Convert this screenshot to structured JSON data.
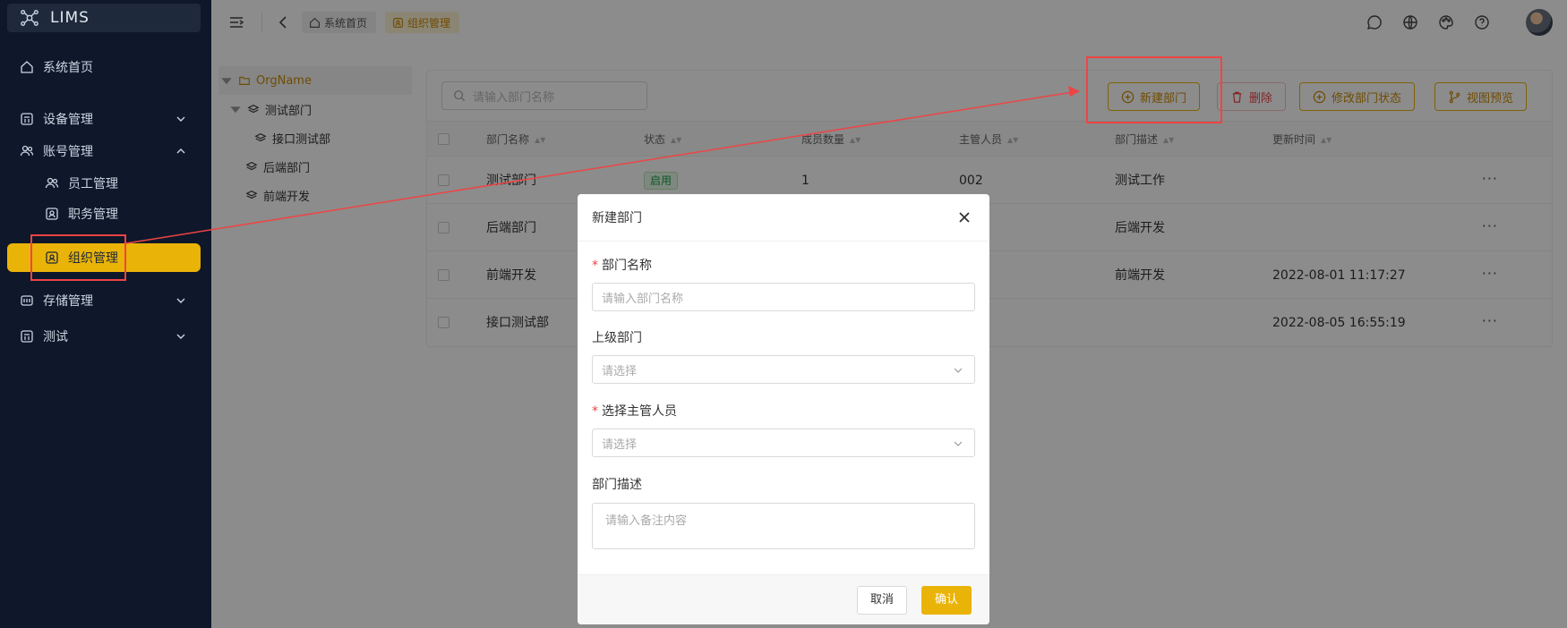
{
  "app": {
    "title": "LIMS"
  },
  "sidebar": {
    "items": [
      {
        "label": "系统首页",
        "icon": "home-icon"
      },
      {
        "label": "设备管理",
        "icon": "calculator-icon"
      },
      {
        "label": "账号管理",
        "icon": "users-icon"
      },
      {
        "label": "员工管理",
        "icon": "users-icon"
      },
      {
        "label": "职务管理",
        "icon": "id-card-icon"
      },
      {
        "label": "组织管理",
        "icon": "id-card-icon"
      },
      {
        "label": "存储管理",
        "icon": "storage-icon"
      },
      {
        "label": "测试",
        "icon": "calculator-icon"
      }
    ]
  },
  "breadcrumb": {
    "home": "系统首页",
    "current": "组织管理"
  },
  "tree": {
    "root": "OrgName",
    "nodes": [
      "测试部门",
      "接口测试部",
      "后端部门",
      "前端开发"
    ]
  },
  "toolbar": {
    "search_placeholder": "请输入部门名称",
    "new_label": "新建部门",
    "delete_label": "删除",
    "status_label": "修改部门状态",
    "preview_label": "视图预览"
  },
  "table": {
    "headers": [
      "部门名称",
      "状态",
      "成员数量",
      "主管人员",
      "部门描述",
      "更新时间"
    ],
    "rows": [
      {
        "name": "测试部门",
        "status": "启用",
        "members": "1",
        "manager": "002",
        "desc": "测试工作",
        "updated": ""
      },
      {
        "name": "后端部门",
        "status": "",
        "members": "",
        "manager": "",
        "desc": "后端开发",
        "updated": ""
      },
      {
        "name": "前端开发",
        "status": "",
        "members": "",
        "manager": "",
        "desc": "前端开发",
        "updated": "2022-08-01 11:17:27"
      },
      {
        "name": "接口测试部",
        "status": "",
        "members": "",
        "manager": "",
        "desc": "",
        "updated": "2022-08-05 16:55:19"
      }
    ],
    "more": "···"
  },
  "modal": {
    "title": "新建部门",
    "name_label": "部门名称",
    "name_placeholder": "请输入部门名称",
    "parent_label": "上级部门",
    "parent_placeholder": "请选择",
    "manager_label": "选择主管人员",
    "manager_placeholder": "请选择",
    "desc_label": "部门描述",
    "desc_placeholder": "请输入备注内容",
    "required_mark": "*",
    "cancel": "取消",
    "confirm": "确认"
  },
  "colors": {
    "accent": "#eab308",
    "annotation": "#ef4444",
    "sidebar_bg": "#0f172a"
  }
}
